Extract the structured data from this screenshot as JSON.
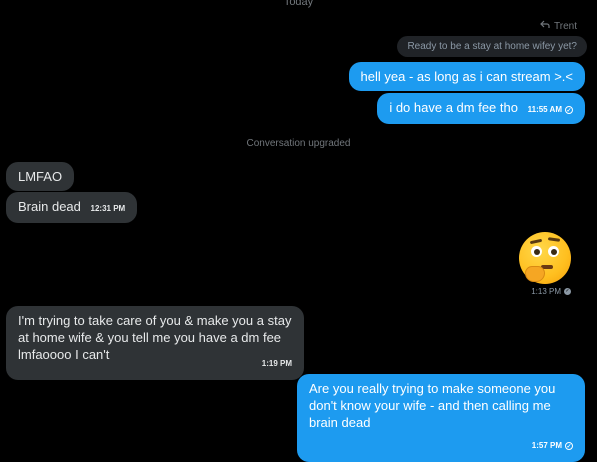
{
  "date_separator": "Today",
  "reply_context": {
    "icon": "reply-arrow-icon",
    "name": "Trent"
  },
  "reply_quote": "Ready to be a stay at home wifey yet?",
  "messages_out_top": [
    {
      "text": "hell yea - as long as i can stream >.<"
    },
    {
      "text": "i do have a dm fee tho",
      "time": "11:55 AM"
    }
  ],
  "system_message": "Conversation upgraded",
  "messages_in_1": [
    {
      "text": "LMFAO"
    },
    {
      "text": "Brain dead",
      "time": "12:31 PM"
    }
  ],
  "emoji_message": {
    "icon": "thinking-face-emoji-icon",
    "time": "1:13 PM"
  },
  "message_in_2": {
    "text": "I'm trying to take care of you & make you a stay at home wife & you tell me you have a dm fee lmfaoooo I can't",
    "time": "1:19 PM"
  },
  "message_out_last": {
    "text": "Are you really trying to make someone you don't know your wife - and then calling me brain dead",
    "time": "1:57 PM"
  },
  "colors": {
    "background": "#000000",
    "outgoing_bubble": "#1d9bf0",
    "incoming_bubble": "#2f3336",
    "muted_text": "#71767b"
  }
}
